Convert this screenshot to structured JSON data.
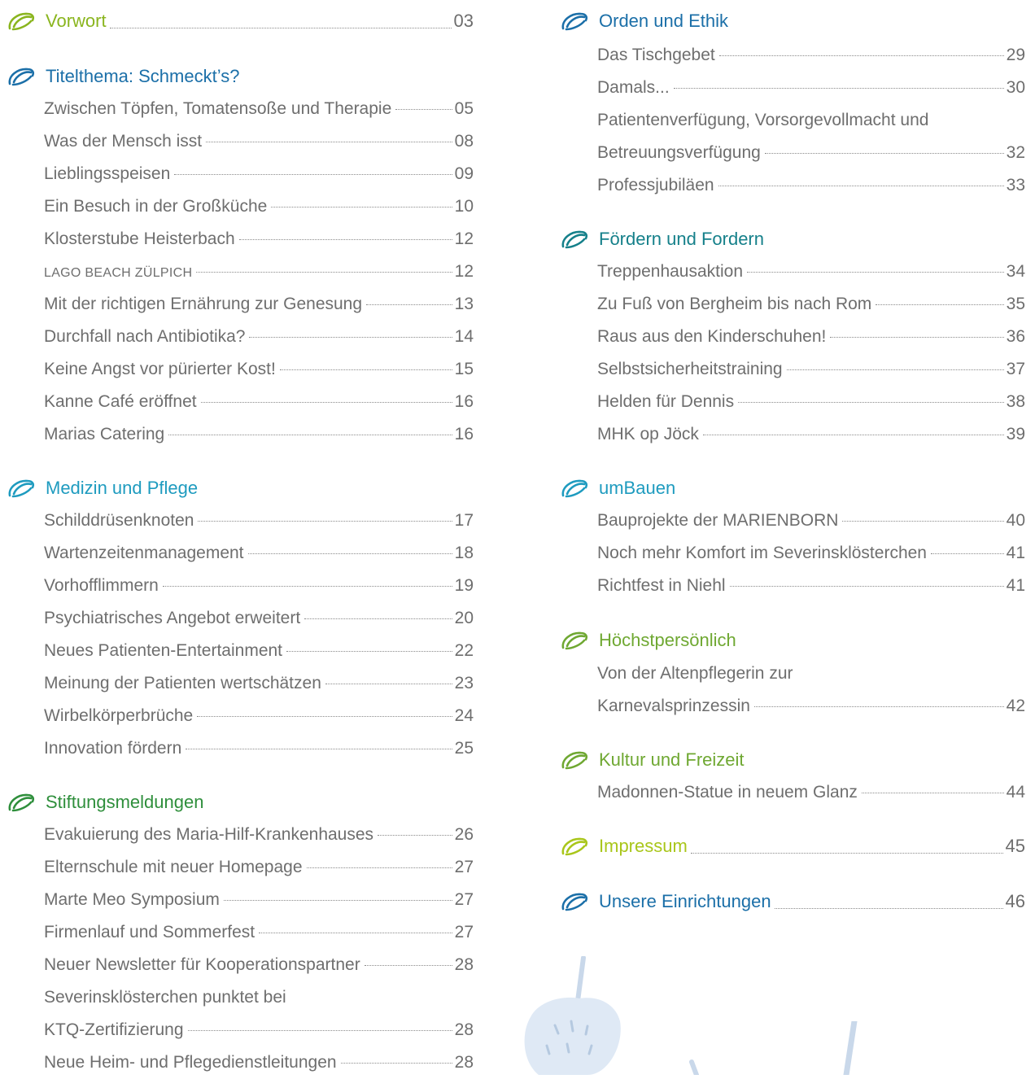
{
  "colors": {
    "green": "#8ab51e",
    "blue": "#1b6fa8",
    "cyan": "#1e9bbf",
    "darkgreen": "#2f8f3c",
    "teal": "#15808a",
    "olive": "#6fa832",
    "lime": "#a9c61a",
    "text": "#6e6e6e"
  },
  "left": {
    "vorwort": {
      "title": "Vorwort",
      "page": "03"
    },
    "titelthema": {
      "title": "Titelthema: Schmeckt’s?",
      "items": [
        {
          "text": "Zwischen Töpfen, Tomatensoße und Therapie",
          "page": "05"
        },
        {
          "text": "Was der Mensch isst",
          "page": "08"
        },
        {
          "text": "Lieblingsspeisen",
          "page": "09"
        },
        {
          "text": "Ein Besuch in der Großküche",
          "page": "10"
        },
        {
          "text": "Klosterstube Heisterbach",
          "page": "12"
        },
        {
          "text": "LAGO BEACH ZÜLPICH",
          "page": "12"
        },
        {
          "text": "Mit der richtigen Ernährung zur Genesung",
          "page": "13"
        },
        {
          "text": "Durchfall nach Antibiotika?",
          "page": "14"
        },
        {
          "text": "Keine Angst vor pürierter Kost!",
          "page": "15"
        },
        {
          "text": "Kanne Café eröffnet",
          "page": "16"
        },
        {
          "text": "Marias Catering",
          "page": "16"
        }
      ]
    },
    "medizin": {
      "title": "Medizin und Pflege",
      "items": [
        {
          "text": "Schilddrüsenknoten",
          "page": "17"
        },
        {
          "text": "Wartenzeitenmanagement",
          "page": "18"
        },
        {
          "text": "Vorhofflimmern",
          "page": "19"
        },
        {
          "text": "Psychiatrisches Angebot erweitert",
          "page": "20"
        },
        {
          "text": "Neues Patienten-Entertainment",
          "page": "22"
        },
        {
          "text": "Meinung der Patienten wertschätzen",
          "page": "23"
        },
        {
          "text": "Wirbelkörperbrüche",
          "page": "24"
        },
        {
          "text": "Innovation fördern",
          "page": "25"
        }
      ]
    },
    "stiftung": {
      "title": "Stiftungsmeldungen",
      "items": [
        {
          "text": "Evakuierung des Maria-Hilf-Krankenhauses",
          "page": "26"
        },
        {
          "text": "Elternschule mit neuer Homepage",
          "page": "27"
        },
        {
          "text": "Marte Meo Symposium",
          "page": "27"
        },
        {
          "text": "Firmenlauf und Sommerfest",
          "page": "27"
        },
        {
          "text": "Neuer Newsletter für Kooperationspartner",
          "page": "28"
        },
        {
          "text": "Severinsklösterchen punktet bei",
          "page": ""
        },
        {
          "text": "KTQ-Zertifizierung",
          "page": "28"
        },
        {
          "text": "Neue Heim- und Pflegedienstleitungen",
          "page": "28"
        }
      ]
    }
  },
  "right": {
    "orden": {
      "title": "Orden und Ethik",
      "items": [
        {
          "text": "Das Tischgebet",
          "page": "29"
        },
        {
          "text": "Damals...",
          "page": "30"
        },
        {
          "text": "Patientenverfügung, Vorsorgevollmacht und",
          "page": ""
        },
        {
          "text": "Betreuungsverfügung",
          "page": "32"
        },
        {
          "text": "Professjubiläen",
          "page": "33"
        }
      ]
    },
    "foerdern": {
      "title": "Fördern und Fordern",
      "items": [
        {
          "text": "Treppenhausaktion",
          "page": "34"
        },
        {
          "text": "Zu Fuß von Bergheim bis nach Rom",
          "page": "35"
        },
        {
          "text": "Raus aus den Kinderschuhen!",
          "page": "36"
        },
        {
          "text": "Selbstsicherheitstraining",
          "page": "37"
        },
        {
          "text": "Helden für Dennis",
          "page": "38"
        },
        {
          "text": "MHK op Jöck",
          "page": "39"
        }
      ]
    },
    "umbauen": {
      "title": "umBauen",
      "items": [
        {
          "text": "Bauprojekte der MARIENBORN",
          "page": "40"
        },
        {
          "text": "Noch mehr Komfort im Severinsklösterchen",
          "page": "41"
        },
        {
          "text": "Richtfest in Niehl",
          "page": "41"
        }
      ]
    },
    "hoechst": {
      "title": "Höchstpersönlich",
      "items": [
        {
          "text": "Von der Altenpflegerin zur",
          "page": ""
        },
        {
          "text": "Karnevalsprinzessin",
          "page": "42"
        }
      ]
    },
    "kultur": {
      "title": "Kultur und Freizeit",
      "items": [
        {
          "text": "Madonnen-Statue in neuem Glanz",
          "page": "44"
        }
      ]
    },
    "impressum": {
      "title": "Impressum",
      "page": "45"
    },
    "einrichtungen": {
      "title": "Unsere Einrichtungen",
      "page": "46"
    }
  }
}
